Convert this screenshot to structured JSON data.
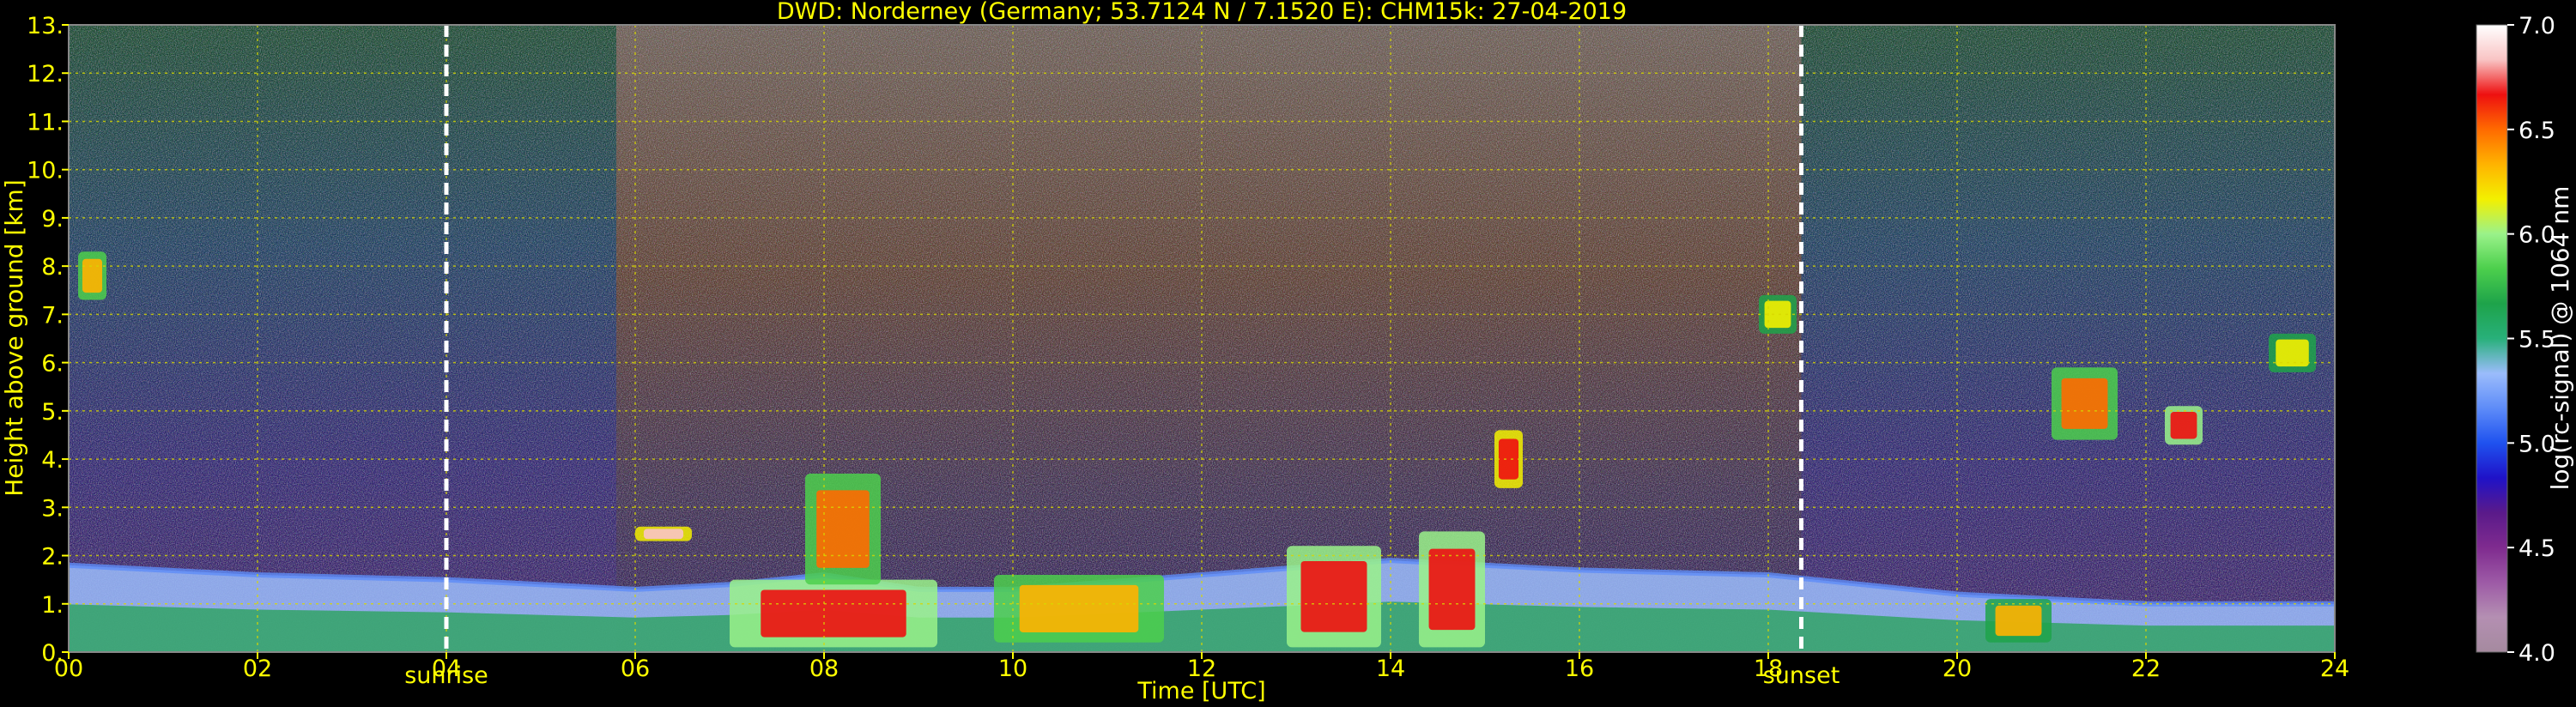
{
  "chart_data": {
    "type": "heatmap",
    "title": "DWD: Norderney (Germany; 53.7124 N / 7.1520 E):    CHM15k: 27-04-2019",
    "xlabel": "Time [UTC]",
    "ylabel": "Height above ground [km]",
    "xlim": [
      0,
      24
    ],
    "ylim": [
      0,
      13
    ],
    "x_ticks": [
      "00",
      "02",
      "04",
      "06",
      "08",
      "10",
      "12",
      "14",
      "16",
      "18",
      "20",
      "22",
      "24"
    ],
    "y_ticks": [
      "0.",
      "1.",
      "2.",
      "3.",
      "4.",
      "5.",
      "6.",
      "7.",
      "8.",
      "9.",
      "10.",
      "11.",
      "12.",
      "13."
    ],
    "grid": true,
    "colorbar": {
      "label": "log(rc-signal) @ 1064 nm",
      "range": [
        4.0,
        7.0
      ],
      "ticks": [
        "4.0",
        "4.5",
        "5.0",
        "5.5",
        "6.0",
        "6.5",
        "7.0"
      ],
      "colors": [
        "#a58a9f",
        "#b48fb2",
        "#9d5aa6",
        "#7f2b8f",
        "#5a1a8a",
        "#1f12c8",
        "#1f52ef",
        "#5e8cf8",
        "#9bbcfb",
        "#28b07a",
        "#1ea34a",
        "#4ccf4c",
        "#9af28a",
        "#f3f000",
        "#ffb300",
        "#ff6a00",
        "#ee1010",
        "#f9c4c4",
        "#ffffff"
      ]
    },
    "annotations": [
      {
        "label": "sunrise",
        "x": 4.0
      },
      {
        "label": "sunset",
        "x": 18.35
      }
    ],
    "features": {
      "boundary_layer": [
        {
          "x": 0.0,
          "top": 1.8
        },
        {
          "x": 2.0,
          "top": 1.6
        },
        {
          "x": 4.0,
          "top": 1.5
        },
        {
          "x": 6.0,
          "top": 1.3
        },
        {
          "x": 7.0,
          "top": 1.4
        },
        {
          "x": 8.0,
          "top": 1.6
        },
        {
          "x": 9.0,
          "top": 1.3
        },
        {
          "x": 10.0,
          "top": 1.3
        },
        {
          "x": 12.0,
          "top": 1.6
        },
        {
          "x": 14.0,
          "top": 1.9
        },
        {
          "x": 16.0,
          "top": 1.7
        },
        {
          "x": 18.0,
          "top": 1.6
        },
        {
          "x": 20.0,
          "top": 1.2
        },
        {
          "x": 22.0,
          "top": 1.0
        },
        {
          "x": 24.0,
          "top": 1.0
        }
      ],
      "clouds": [
        {
          "x0": 7.0,
          "x1": 9.2,
          "y0": 0.1,
          "y1": 1.5,
          "level": 6.6
        },
        {
          "x0": 7.8,
          "x1": 8.6,
          "y0": 1.4,
          "y1": 3.7,
          "level": 6.5
        },
        {
          "x0": 9.8,
          "x1": 11.6,
          "y0": 0.2,
          "y1": 1.6,
          "level": 6.4
        },
        {
          "x0": 12.9,
          "x1": 13.9,
          "y0": 0.1,
          "y1": 2.2,
          "level": 6.6
        },
        {
          "x0": 14.3,
          "x1": 15.0,
          "y0": 0.1,
          "y1": 2.5,
          "level": 6.6
        },
        {
          "x0": 15.1,
          "x1": 15.4,
          "y0": 3.4,
          "y1": 4.6,
          "level": 6.7
        },
        {
          "x0": 6.0,
          "x1": 6.6,
          "y0": 2.3,
          "y1": 2.6,
          "level": 6.8
        },
        {
          "x0": 0.1,
          "x1": 0.4,
          "y0": 7.3,
          "y1": 8.3,
          "level": 6.4
        },
        {
          "x0": 17.9,
          "x1": 18.3,
          "y0": 6.6,
          "y1": 7.4,
          "level": 6.2
        },
        {
          "x0": 21.0,
          "x1": 21.7,
          "y0": 4.4,
          "y1": 5.9,
          "level": 6.5
        },
        {
          "x0": 22.2,
          "x1": 22.6,
          "y0": 4.3,
          "y1": 5.1,
          "level": 6.6
        },
        {
          "x0": 23.3,
          "x1": 23.8,
          "y0": 5.8,
          "y1": 6.6,
          "level": 6.2
        },
        {
          "x0": 20.3,
          "x1": 21.0,
          "y0": 0.2,
          "y1": 1.1,
          "level": 6.3
        }
      ]
    }
  }
}
